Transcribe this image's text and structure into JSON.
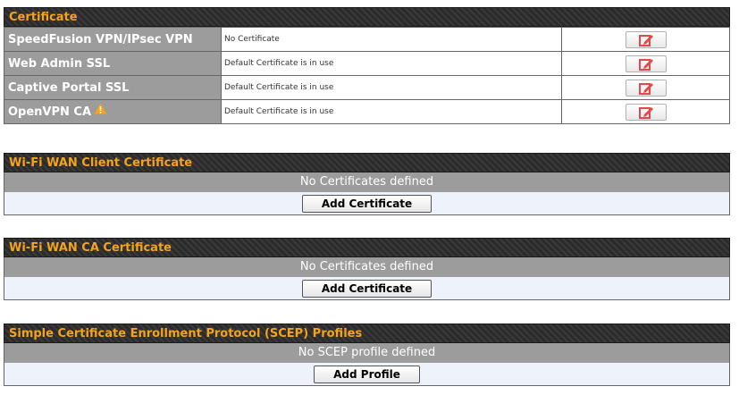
{
  "certificate": {
    "title": "Certificate",
    "rows": [
      {
        "label": "SpeedFusion VPN/IPsec VPN",
        "status": "No Certificate"
      },
      {
        "label": "Web Admin SSL",
        "status": "Default Certificate is in use"
      },
      {
        "label": "Captive Portal SSL",
        "status": "Default Certificate is in use"
      },
      {
        "label": "OpenVPN CA",
        "status": "Default Certificate is in use"
      }
    ],
    "edit_icon": "edit-icon",
    "warning_icon": "warning-icon"
  },
  "wifi_wan_client": {
    "title": "Wi-Fi WAN Client Certificate",
    "empty_message": "No Certificates defined",
    "add_label": "Add Certificate"
  },
  "wifi_wan_ca": {
    "title": "Wi-Fi WAN CA Certificate",
    "empty_message": "No Certificates defined",
    "add_label": "Add Certificate"
  },
  "scep": {
    "title": "Simple Certificate Enrollment Protocol (SCEP) Profiles",
    "empty_message": "No SCEP profile defined",
    "add_label": "Add Profile"
  },
  "colors": {
    "header_bg": "#2b2b2b",
    "header_text": "#f5a31a",
    "label_bg": "#9c9c9c",
    "edit_icon": "#e24a4a",
    "warning": "#f5a31a"
  }
}
